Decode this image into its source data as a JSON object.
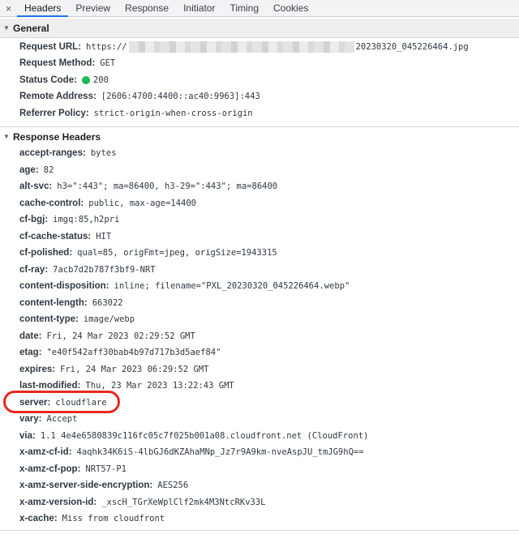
{
  "tabs": {
    "close": "×",
    "items": [
      "Headers",
      "Preview",
      "Response",
      "Initiator",
      "Timing",
      "Cookies"
    ],
    "active": "Headers"
  },
  "general": {
    "title": "General",
    "request_url_key": "Request URL:",
    "request_url_prefix": "https://",
    "request_url_suffix": "20230320_045226464.jpg",
    "request_method_key": "Request Method:",
    "request_method": "GET",
    "status_code_key": "Status Code:",
    "status_code": "200",
    "status_color": "#1db954",
    "remote_address_key": "Remote Address:",
    "remote_address": "[2606:4700:4400::ac40:9963]:443",
    "referrer_policy_key": "Referrer Policy:",
    "referrer_policy": "strict-origin-when-cross-origin"
  },
  "response_headers": {
    "title": "Response Headers",
    "items": [
      {
        "key": "accept-ranges:",
        "value": "bytes"
      },
      {
        "key": "age:",
        "value": "82"
      },
      {
        "key": "alt-svc:",
        "value": "h3=\":443\"; ma=86400, h3-29=\":443\"; ma=86400"
      },
      {
        "key": "cache-control:",
        "value": "public, max-age=14400"
      },
      {
        "key": "cf-bgj:",
        "value": "imgq:85,h2pri"
      },
      {
        "key": "cf-cache-status:",
        "value": "HIT"
      },
      {
        "key": "cf-polished:",
        "value": "qual=85, origFmt=jpeg, origSize=1943315"
      },
      {
        "key": "cf-ray:",
        "value": "7acb7d2b787f3bf9-NRT"
      },
      {
        "key": "content-disposition:",
        "value": "inline; filename=\"PXL_20230320_045226464.webp\""
      },
      {
        "key": "content-length:",
        "value": "663022"
      },
      {
        "key": "content-type:",
        "value": "image/webp"
      },
      {
        "key": "date:",
        "value": "Fri, 24 Mar 2023 02:29:52 GMT"
      },
      {
        "key": "etag:",
        "value": "\"e40f542aff30bab4b97d717b3d5aef84\""
      },
      {
        "key": "expires:",
        "value": "Fri, 24 Mar 2023 06:29:52 GMT"
      },
      {
        "key": "last-modified:",
        "value": "Thu, 23 Mar 2023 13:22:43 GMT"
      },
      {
        "key": "server:",
        "value": "cloudflare"
      },
      {
        "key": "vary:",
        "value": "Accept"
      },
      {
        "key": "via:",
        "value": "1.1 4e4e6580839c116fc05c7f025b001a08.cloudfront.net (CloudFront)"
      },
      {
        "key": "x-amz-cf-id:",
        "value": "4aqhk34K6iS-4lbGJ6dKZAhaMNp_Jz7r9A9km-nveAspJU_tmJG9hQ=="
      },
      {
        "key": "x-amz-cf-pop:",
        "value": "NRT57-P1"
      },
      {
        "key": "x-amz-server-side-encryption:",
        "value": "AES256"
      },
      {
        "key": "x-amz-version-id:",
        "value": "_xscH_TGrXeWplClf2mk4M3NtcRKv33L"
      },
      {
        "key": "x-cache:",
        "value": "Miss from cloudfront"
      }
    ]
  },
  "highlight_color": "#e8291f"
}
